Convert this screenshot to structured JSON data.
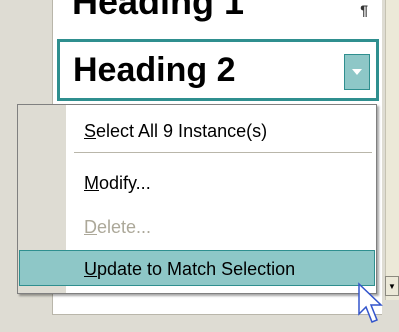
{
  "styles_pane": {
    "heading1_label": "Heading 1",
    "heading1_mark": "¶",
    "heading2_label": "Heading 2"
  },
  "context_menu": {
    "items": [
      {
        "prefix": "",
        "accel": "S",
        "rest": "elect All 9 Instance(s)",
        "enabled": true
      },
      {
        "prefix": "",
        "accel": "M",
        "rest": "odify...",
        "enabled": true
      },
      {
        "prefix": "",
        "accel": "D",
        "rest": "elete...",
        "enabled": false
      },
      {
        "prefix": "",
        "accel": "U",
        "rest": "pdate to Match Selection",
        "enabled": true,
        "highlighted": true
      }
    ]
  },
  "colors": {
    "accent": "#2f8f8f",
    "highlight": "#8ec7c7",
    "disabled_text": "#aca899"
  },
  "icons": {
    "dropdown": "chevron-down-icon",
    "scroll_down": "scroll-down-arrow-icon",
    "cursor": "mouse-pointer-icon"
  }
}
